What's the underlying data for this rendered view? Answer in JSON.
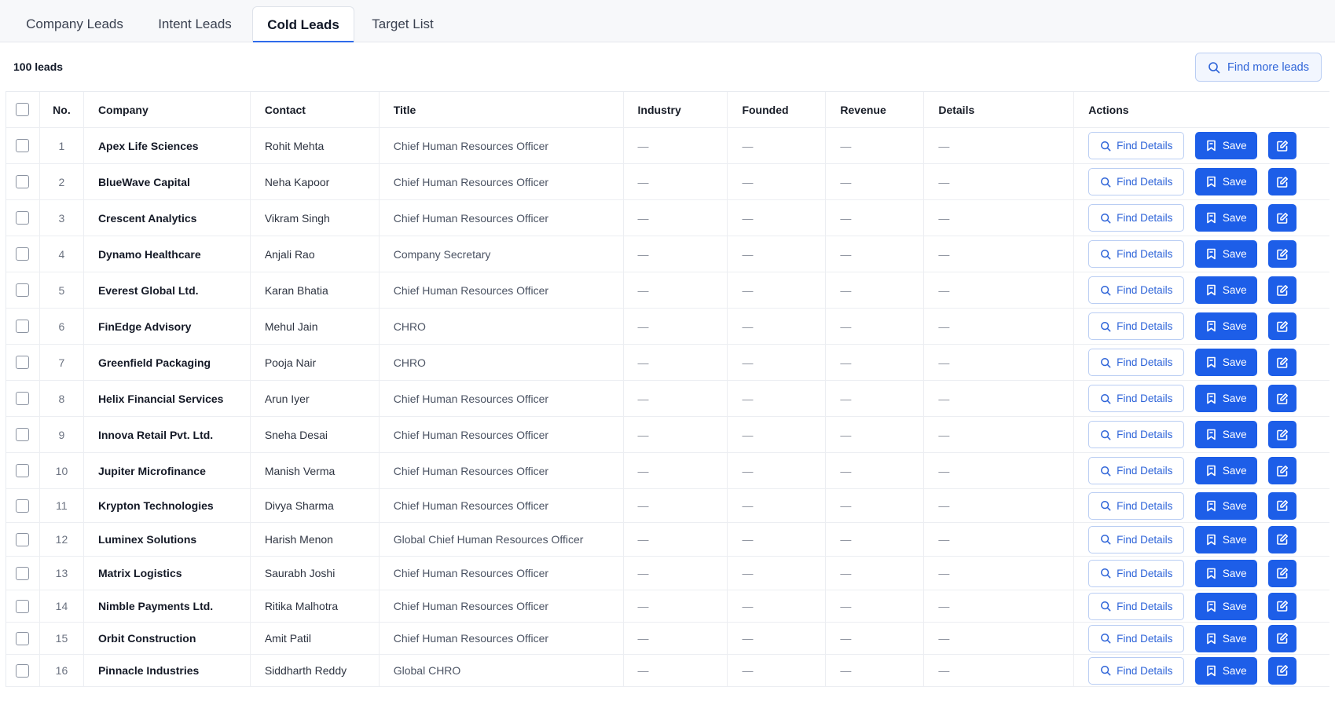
{
  "tabs": [
    {
      "label": "Company Leads",
      "active": false
    },
    {
      "label": "Intent Leads",
      "active": false
    },
    {
      "label": "Cold Leads",
      "active": true
    },
    {
      "label": "Target List",
      "active": false
    }
  ],
  "leads_count": "100 leads",
  "find_more_label": "Find more leads",
  "columns": {
    "no": "No.",
    "company": "Company",
    "contact": "Contact",
    "title": "Title",
    "industry": "Industry",
    "founded": "Founded",
    "revenue": "Revenue",
    "details": "Details",
    "actions": "Actions"
  },
  "empty_placeholder": "—",
  "actions": {
    "find_details": "Find Details",
    "save": "Save"
  },
  "icons": {
    "search": "search-icon",
    "save": "bookmark-icon",
    "edit": "edit-icon",
    "checkbox": "checkbox"
  },
  "colors": {
    "accent": "#1d5ee8",
    "accent_outline": "#b9cdf3",
    "tab_underline": "#2f6bea"
  },
  "rows": [
    {
      "no": "1",
      "company": "Apex Life Sciences",
      "contact": "Rohit Mehta",
      "title": "Chief Human Resources Officer",
      "industry": "—",
      "founded": "—",
      "revenue": "—",
      "details": "—"
    },
    {
      "no": "2",
      "company": "BlueWave Capital",
      "contact": "Neha Kapoor",
      "title": "Chief Human Resources Officer",
      "industry": "—",
      "founded": "—",
      "revenue": "—",
      "details": "—"
    },
    {
      "no": "3",
      "company": "Crescent Analytics",
      "contact": "Vikram Singh",
      "title": "Chief Human Resources Officer",
      "industry": "—",
      "founded": "—",
      "revenue": "—",
      "details": "—"
    },
    {
      "no": "4",
      "company": "Dynamo Healthcare",
      "contact": "Anjali Rao",
      "title": "Company Secretary",
      "industry": "—",
      "founded": "—",
      "revenue": "—",
      "details": "—"
    },
    {
      "no": "5",
      "company": "Everest Global Ltd.",
      "contact": "Karan Bhatia",
      "title": "Chief Human Resources Officer",
      "industry": "—",
      "founded": "—",
      "revenue": "—",
      "details": "—"
    },
    {
      "no": "6",
      "company": "FinEdge Advisory",
      "contact": "Mehul Jain",
      "title": "CHRO",
      "industry": "—",
      "founded": "—",
      "revenue": "—",
      "details": "—"
    },
    {
      "no": "7",
      "company": "Greenfield Packaging",
      "contact": "Pooja Nair",
      "title": "CHRO",
      "industry": "—",
      "founded": "—",
      "revenue": "—",
      "details": "—"
    },
    {
      "no": "8",
      "company": "Helix Financial Services",
      "contact": "Arun Iyer",
      "title": "Chief Human Resources Officer",
      "industry": "—",
      "founded": "—",
      "revenue": "—",
      "details": "—"
    },
    {
      "no": "9",
      "company": "Innova Retail Pvt. Ltd.",
      "contact": "Sneha Desai",
      "title": "Chief Human Resources Officer",
      "industry": "—",
      "founded": "—",
      "revenue": "—",
      "details": "—"
    },
    {
      "no": "10",
      "company": "Jupiter Microfinance",
      "contact": "Manish Verma",
      "title": "Chief Human Resources Officer",
      "industry": "—",
      "founded": "—",
      "revenue": "—",
      "details": "—"
    },
    {
      "no": "11",
      "company": "Krypton Technologies",
      "contact": "Divya Sharma",
      "title": "Chief Human Resources Officer",
      "industry": "—",
      "founded": "—",
      "revenue": "—",
      "details": "—"
    },
    {
      "no": "12",
      "company": "Luminex Solutions",
      "contact": "Harish Menon",
      "title": "Global Chief Human Resources Officer",
      "industry": "—",
      "founded": "—",
      "revenue": "—",
      "details": "—"
    },
    {
      "no": "13",
      "company": "Matrix Logistics",
      "contact": "Saurabh Joshi",
      "title": "Chief Human Resources Officer",
      "industry": "—",
      "founded": "—",
      "revenue": "—",
      "details": "—"
    },
    {
      "no": "14",
      "company": "Nimble Payments Ltd.",
      "contact": "Ritika Malhotra",
      "title": "Chief Human Resources Officer",
      "industry": "—",
      "founded": "—",
      "revenue": "—",
      "details": "—"
    },
    {
      "no": "15",
      "company": "Orbit Construction",
      "contact": "Amit Patil",
      "title": "Chief Human Resources Officer",
      "industry": "—",
      "founded": "—",
      "revenue": "—",
      "details": "—"
    },
    {
      "no": "16",
      "company": "Pinnacle Industries",
      "contact": "Siddharth Reddy",
      "title": "Global CHRO",
      "industry": "—",
      "founded": "—",
      "revenue": "—",
      "details": "—"
    }
  ]
}
